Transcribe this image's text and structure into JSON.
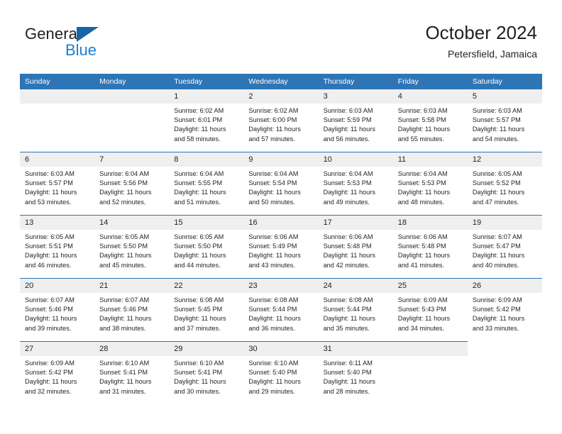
{
  "logo": {
    "word1": "General",
    "word2": "Blue",
    "triangle_color": "#1565a8",
    "blue_color": "#1b7fd4",
    "icon": "general-blue-logo"
  },
  "header": {
    "title": "October 2024",
    "subtitle": "Petersfield, Jamaica",
    "header_bg": "#2e75b6",
    "daynum_bg": "#efefef"
  },
  "weekdays": [
    "Sunday",
    "Monday",
    "Tuesday",
    "Wednesday",
    "Thursday",
    "Friday",
    "Saturday"
  ],
  "labels": {
    "sunrise": "Sunrise:",
    "sunset": "Sunset:",
    "daylight": "Daylight:"
  },
  "weeks": [
    [
      {
        "day": "",
        "empty": true
      },
      {
        "day": "",
        "empty": true
      },
      {
        "day": "1",
        "sunrise": "Sunrise: 6:02 AM",
        "sunset": "Sunset: 6:01 PM",
        "daylight1": "Daylight: 11 hours",
        "daylight2": "and 58 minutes."
      },
      {
        "day": "2",
        "sunrise": "Sunrise: 6:02 AM",
        "sunset": "Sunset: 6:00 PM",
        "daylight1": "Daylight: 11 hours",
        "daylight2": "and 57 minutes."
      },
      {
        "day": "3",
        "sunrise": "Sunrise: 6:03 AM",
        "sunset": "Sunset: 5:59 PM",
        "daylight1": "Daylight: 11 hours",
        "daylight2": "and 56 minutes."
      },
      {
        "day": "4",
        "sunrise": "Sunrise: 6:03 AM",
        "sunset": "Sunset: 5:58 PM",
        "daylight1": "Daylight: 11 hours",
        "daylight2": "and 55 minutes."
      },
      {
        "day": "5",
        "sunrise": "Sunrise: 6:03 AM",
        "sunset": "Sunset: 5:57 PM",
        "daylight1": "Daylight: 11 hours",
        "daylight2": "and 54 minutes."
      }
    ],
    [
      {
        "day": "6",
        "sunrise": "Sunrise: 6:03 AM",
        "sunset": "Sunset: 5:57 PM",
        "daylight1": "Daylight: 11 hours",
        "daylight2": "and 53 minutes."
      },
      {
        "day": "7",
        "sunrise": "Sunrise: 6:04 AM",
        "sunset": "Sunset: 5:56 PM",
        "daylight1": "Daylight: 11 hours",
        "daylight2": "and 52 minutes."
      },
      {
        "day": "8",
        "sunrise": "Sunrise: 6:04 AM",
        "sunset": "Sunset: 5:55 PM",
        "daylight1": "Daylight: 11 hours",
        "daylight2": "and 51 minutes."
      },
      {
        "day": "9",
        "sunrise": "Sunrise: 6:04 AM",
        "sunset": "Sunset: 5:54 PM",
        "daylight1": "Daylight: 11 hours",
        "daylight2": "and 50 minutes."
      },
      {
        "day": "10",
        "sunrise": "Sunrise: 6:04 AM",
        "sunset": "Sunset: 5:53 PM",
        "daylight1": "Daylight: 11 hours",
        "daylight2": "and 49 minutes."
      },
      {
        "day": "11",
        "sunrise": "Sunrise: 6:04 AM",
        "sunset": "Sunset: 5:53 PM",
        "daylight1": "Daylight: 11 hours",
        "daylight2": "and 48 minutes."
      },
      {
        "day": "12",
        "sunrise": "Sunrise: 6:05 AM",
        "sunset": "Sunset: 5:52 PM",
        "daylight1": "Daylight: 11 hours",
        "daylight2": "and 47 minutes."
      }
    ],
    [
      {
        "day": "13",
        "sunrise": "Sunrise: 6:05 AM",
        "sunset": "Sunset: 5:51 PM",
        "daylight1": "Daylight: 11 hours",
        "daylight2": "and 46 minutes."
      },
      {
        "day": "14",
        "sunrise": "Sunrise: 6:05 AM",
        "sunset": "Sunset: 5:50 PM",
        "daylight1": "Daylight: 11 hours",
        "daylight2": "and 45 minutes."
      },
      {
        "day": "15",
        "sunrise": "Sunrise: 6:05 AM",
        "sunset": "Sunset: 5:50 PM",
        "daylight1": "Daylight: 11 hours",
        "daylight2": "and 44 minutes."
      },
      {
        "day": "16",
        "sunrise": "Sunrise: 6:06 AM",
        "sunset": "Sunset: 5:49 PM",
        "daylight1": "Daylight: 11 hours",
        "daylight2": "and 43 minutes."
      },
      {
        "day": "17",
        "sunrise": "Sunrise: 6:06 AM",
        "sunset": "Sunset: 5:48 PM",
        "daylight1": "Daylight: 11 hours",
        "daylight2": "and 42 minutes."
      },
      {
        "day": "18",
        "sunrise": "Sunrise: 6:06 AM",
        "sunset": "Sunset: 5:48 PM",
        "daylight1": "Daylight: 11 hours",
        "daylight2": "and 41 minutes."
      },
      {
        "day": "19",
        "sunrise": "Sunrise: 6:07 AM",
        "sunset": "Sunset: 5:47 PM",
        "daylight1": "Daylight: 11 hours",
        "daylight2": "and 40 minutes."
      }
    ],
    [
      {
        "day": "20",
        "sunrise": "Sunrise: 6:07 AM",
        "sunset": "Sunset: 5:46 PM",
        "daylight1": "Daylight: 11 hours",
        "daylight2": "and 39 minutes."
      },
      {
        "day": "21",
        "sunrise": "Sunrise: 6:07 AM",
        "sunset": "Sunset: 5:46 PM",
        "daylight1": "Daylight: 11 hours",
        "daylight2": "and 38 minutes."
      },
      {
        "day": "22",
        "sunrise": "Sunrise: 6:08 AM",
        "sunset": "Sunset: 5:45 PM",
        "daylight1": "Daylight: 11 hours",
        "daylight2": "and 37 minutes."
      },
      {
        "day": "23",
        "sunrise": "Sunrise: 6:08 AM",
        "sunset": "Sunset: 5:44 PM",
        "daylight1": "Daylight: 11 hours",
        "daylight2": "and 36 minutes."
      },
      {
        "day": "24",
        "sunrise": "Sunrise: 6:08 AM",
        "sunset": "Sunset: 5:44 PM",
        "daylight1": "Daylight: 11 hours",
        "daylight2": "and 35 minutes."
      },
      {
        "day": "25",
        "sunrise": "Sunrise: 6:09 AM",
        "sunset": "Sunset: 5:43 PM",
        "daylight1": "Daylight: 11 hours",
        "daylight2": "and 34 minutes."
      },
      {
        "day": "26",
        "sunrise": "Sunrise: 6:09 AM",
        "sunset": "Sunset: 5:42 PM",
        "daylight1": "Daylight: 11 hours",
        "daylight2": "and 33 minutes."
      }
    ],
    [
      {
        "day": "27",
        "sunrise": "Sunrise: 6:09 AM",
        "sunset": "Sunset: 5:42 PM",
        "daylight1": "Daylight: 11 hours",
        "daylight2": "and 32 minutes."
      },
      {
        "day": "28",
        "sunrise": "Sunrise: 6:10 AM",
        "sunset": "Sunset: 5:41 PM",
        "daylight1": "Daylight: 11 hours",
        "daylight2": "and 31 minutes."
      },
      {
        "day": "29",
        "sunrise": "Sunrise: 6:10 AM",
        "sunset": "Sunset: 5:41 PM",
        "daylight1": "Daylight: 11 hours",
        "daylight2": "and 30 minutes."
      },
      {
        "day": "30",
        "sunrise": "Sunrise: 6:10 AM",
        "sunset": "Sunset: 5:40 PM",
        "daylight1": "Daylight: 11 hours",
        "daylight2": "and 29 minutes."
      },
      {
        "day": "31",
        "sunrise": "Sunrise: 6:11 AM",
        "sunset": "Sunset: 5:40 PM",
        "daylight1": "Daylight: 11 hours",
        "daylight2": "and 28 minutes."
      },
      {
        "day": "",
        "empty": true
      },
      {
        "day": "",
        "empty": true,
        "void": true
      }
    ]
  ]
}
